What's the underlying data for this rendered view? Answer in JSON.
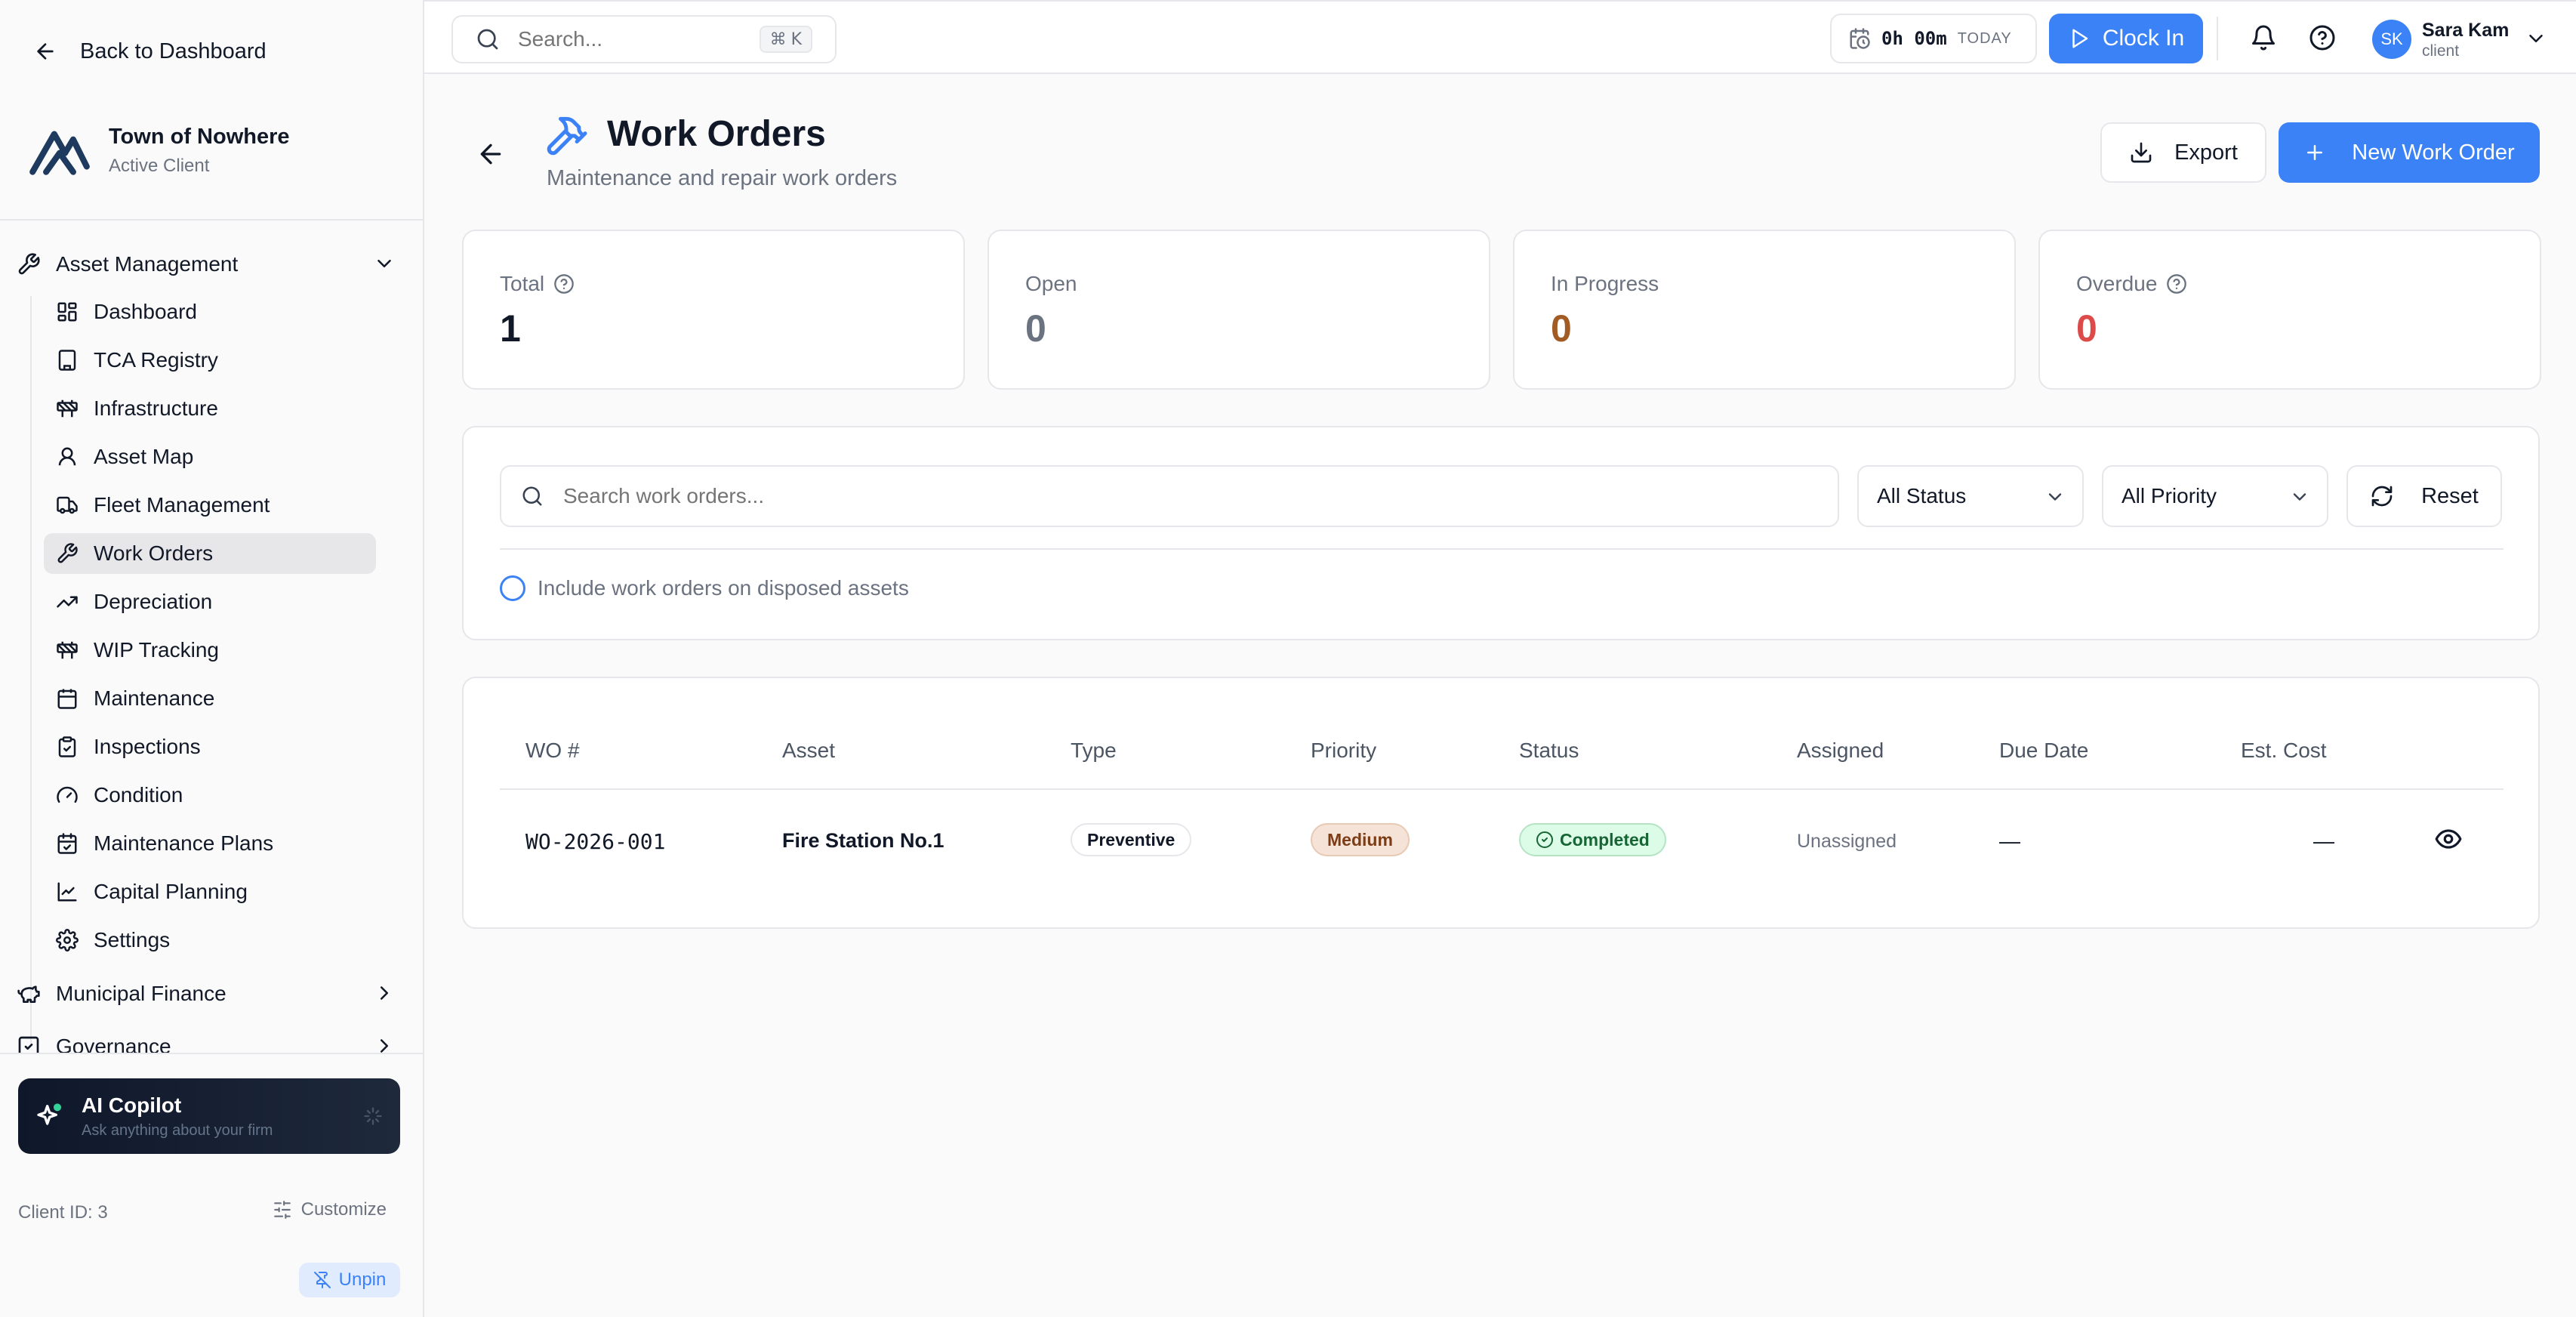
{
  "sidebar": {
    "back_label": "Back to Dashboard",
    "client_name": "Town of Nowhere",
    "client_status": "Active Client",
    "groups": {
      "asset_management": "Asset Management",
      "municipal_finance": "Municipal Finance",
      "governance": "Governance"
    },
    "items": [
      {
        "label": "Dashboard",
        "icon": "dashboard-icon"
      },
      {
        "label": "TCA Registry",
        "icon": "building-icon"
      },
      {
        "label": "Infrastructure",
        "icon": "construction-icon"
      },
      {
        "label": "Asset Map",
        "icon": "map-pin-icon"
      },
      {
        "label": "Fleet Management",
        "icon": "truck-icon"
      },
      {
        "label": "Work Orders",
        "icon": "wrench-icon"
      },
      {
        "label": "Depreciation",
        "icon": "trending-icon"
      },
      {
        "label": "WIP Tracking",
        "icon": "construction-icon"
      },
      {
        "label": "Maintenance",
        "icon": "calendar-icon"
      },
      {
        "label": "Inspections",
        "icon": "clipboard-icon"
      },
      {
        "label": "Condition",
        "icon": "gauge-icon"
      },
      {
        "label": "Maintenance Plans",
        "icon": "calendar-check-icon"
      },
      {
        "label": "Capital Planning",
        "icon": "line-chart-icon"
      },
      {
        "label": "Settings",
        "icon": "gear-icon"
      }
    ],
    "active_item": "Work Orders",
    "copilot_title": "AI Copilot",
    "copilot_subtitle": "Ask anything about your firm",
    "client_id": "Client ID: 3",
    "customize_label": "Customize",
    "unpin_label": "Unpin"
  },
  "topbar": {
    "search_placeholder": "Search...",
    "shortcut_symbol": "⌘",
    "shortcut_key": "K",
    "timer_value": "0h 00m",
    "timer_label": "TODAY",
    "clock_in_label": "Clock In",
    "user_initials": "SK",
    "user_name": "Sara Kam",
    "user_role": "client"
  },
  "page": {
    "title": "Work Orders",
    "subtitle": "Maintenance and repair work orders",
    "export_label": "Export",
    "new_label": "New Work Order"
  },
  "stats": [
    {
      "label": "Total",
      "value": "1",
      "color": "#111827"
    },
    {
      "label": "Open",
      "value": "0",
      "color": "#6b7280"
    },
    {
      "label": "In Progress",
      "value": "0",
      "color": "#a15c25"
    },
    {
      "label": "Overdue",
      "value": "0",
      "color": "#dc4a4a"
    }
  ],
  "filters": {
    "search_placeholder": "Search work orders...",
    "status_value": "All Status",
    "priority_value": "All Priority",
    "reset_label": "Reset",
    "include_disposed_label": "Include work orders on disposed assets"
  },
  "table": {
    "headers": [
      "WO #",
      "Asset",
      "Type",
      "Priority",
      "Status",
      "Assigned",
      "Due Date",
      "Est. Cost"
    ],
    "rows": [
      {
        "wo": "WO-2026-001",
        "asset": "Fire Station No.1",
        "type": "Preventive",
        "priority": "Medium",
        "status": "Completed",
        "assigned": "Unassigned",
        "due_date": "—",
        "est_cost": "—"
      }
    ]
  },
  "colors": {
    "accent": "#3b82f6",
    "status_completed": "#166534",
    "priority_medium": "#7c3d16"
  }
}
